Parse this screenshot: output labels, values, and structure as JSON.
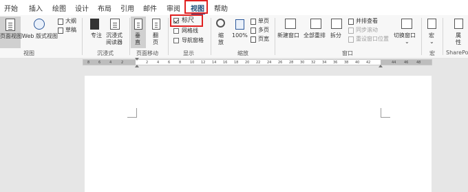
{
  "tabs": [
    {
      "label": "开始",
      "active": false
    },
    {
      "label": "插入",
      "active": false
    },
    {
      "label": "绘图",
      "active": false
    },
    {
      "label": "设计",
      "active": false
    },
    {
      "label": "布局",
      "active": false
    },
    {
      "label": "引用",
      "active": false
    },
    {
      "label": "邮件",
      "active": false
    },
    {
      "label": "审阅",
      "active": false
    },
    {
      "label": "视图",
      "active": true
    },
    {
      "label": "帮助",
      "active": false
    }
  ],
  "ribbon": {
    "views": {
      "print_layout": "页面视图",
      "web_layout": "Web 版式视图",
      "outline": "大纲",
      "draft": "草稿",
      "group": "视图"
    },
    "immersive": {
      "focus": "专注",
      "reader_line1": "沉浸式",
      "reader_line2": "阅读器",
      "group": "沉浸式"
    },
    "page_move": {
      "vertical_line1": "垂",
      "vertical_line2": "直",
      "side_line1": "翻",
      "side_line2": "页",
      "group": "页面移动"
    },
    "show": {
      "ruler": {
        "label": "标尺",
        "checked": true
      },
      "gridlines": {
        "label": "网格线",
        "checked": false
      },
      "nav_pane": {
        "label": "导航窗格",
        "checked": false
      },
      "group": "显示"
    },
    "zoom": {
      "zoom_line1": "缩",
      "zoom_line2": "放",
      "percent": "100%",
      "one_page": "单页",
      "multi_page": "多页",
      "page_width": "页宽",
      "group": "缩放"
    },
    "window": {
      "new_window": "新建窗口",
      "arrange_all": "全部重排",
      "split": "拆分",
      "side_by_side": "并排查看",
      "sync_scroll": "同步滚动",
      "reset_position": "重设窗口位置",
      "switch_windows": "切换窗口",
      "group": "窗口"
    },
    "macros": {
      "label": "宏",
      "group": "宏"
    },
    "sharepoint": {
      "properties_line1": "属",
      "properties_line2": "性",
      "group": "SharePoint"
    }
  },
  "ruler_numbers": [
    "8",
    "6",
    "4",
    "2",
    "2",
    "4",
    "6",
    "8",
    "10",
    "12",
    "14",
    "16",
    "18",
    "20",
    "22",
    "24",
    "26",
    "28",
    "30",
    "32",
    "34",
    "36",
    "38",
    "40",
    "42",
    "44",
    "46",
    "48"
  ],
  "colors": {
    "accent": "#2b579a",
    "highlight": "#e02020",
    "page": "#ffffff",
    "background": "#e6e6e6"
  }
}
